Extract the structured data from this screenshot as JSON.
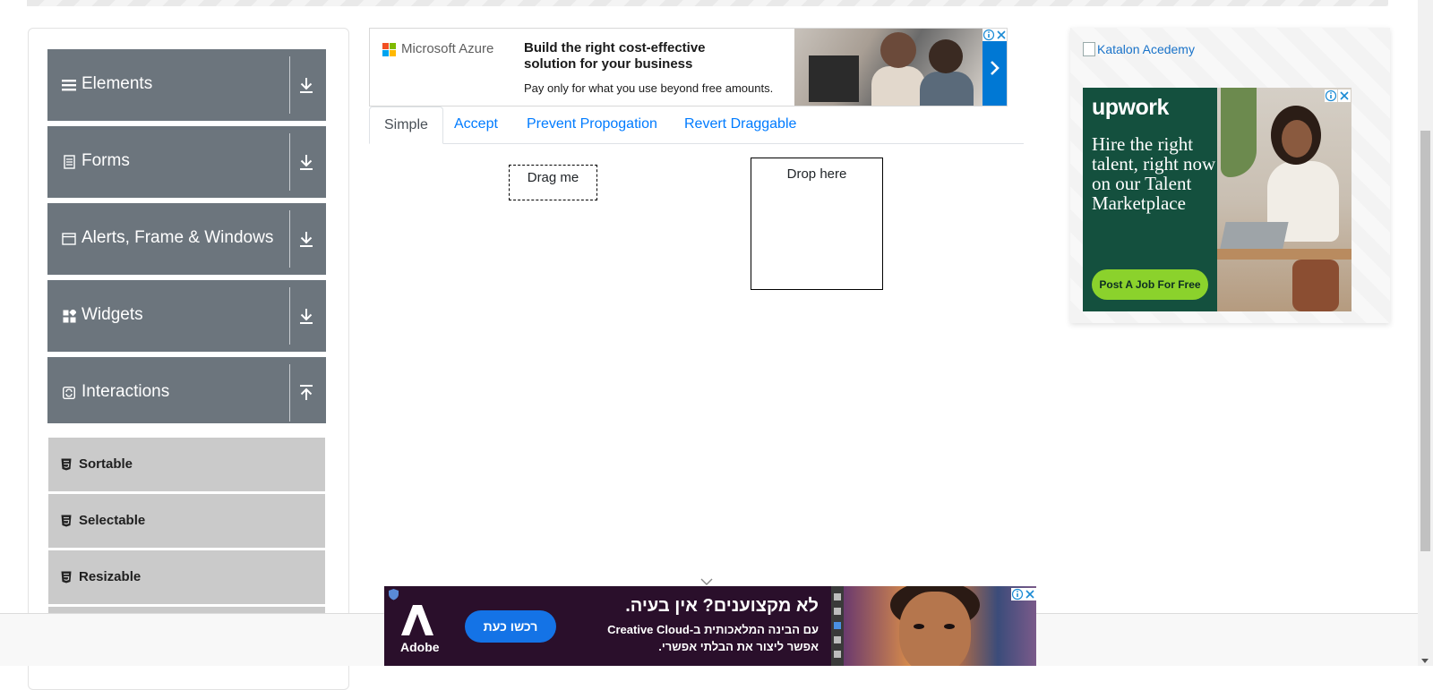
{
  "sidebar": {
    "groups": [
      {
        "label": "Elements",
        "icon": "menu-lines-icon",
        "expanded": false
      },
      {
        "label": "Forms",
        "icon": "form-icon",
        "expanded": false
      },
      {
        "label": "Alerts, Frame & Windows",
        "icon": "window-icon",
        "expanded": false
      },
      {
        "label": "Widgets",
        "icon": "widgets-icon",
        "expanded": false
      },
      {
        "label": "Interactions",
        "icon": "interactions-icon",
        "expanded": true
      }
    ],
    "interaction_items": [
      {
        "label": "Sortable",
        "icon": "html5-icon"
      },
      {
        "label": "Selectable",
        "icon": "html5-icon"
      },
      {
        "label": "Resizable",
        "icon": "html5-icon"
      }
    ],
    "colors": {
      "header_bg": "#6c757d",
      "item_bg": "#cacaca"
    }
  },
  "ad_top": {
    "brand": "Microsoft Azure",
    "headline": "Build the right cost-effective solution for your business",
    "subtext": "Pay only for what you use beyond free amounts.",
    "accent": "#0078d4"
  },
  "tabs": [
    {
      "label": "Simple",
      "active": true
    },
    {
      "label": "Accept",
      "active": false
    },
    {
      "label": "Prevent Propogation",
      "active": false
    },
    {
      "label": "Revert Draggable",
      "active": false
    }
  ],
  "drag": {
    "draggable_label": "Drag me",
    "droppable_label": "Drop here"
  },
  "ad_right": {
    "broken_image_alt": "Katalon Acedemy",
    "brand": "upwork",
    "headline": "Hire the right talent, right now on our Talent Marketplace",
    "cta": "Post A Job For Free",
    "colors": {
      "panel": "#14503e",
      "cta": "#8bd22c"
    }
  },
  "ad_bottom": {
    "brand": "Adobe",
    "cta": "רכשו כעת",
    "headline": "לא מקצוענים? אין בעיה.",
    "line1": "עם הבינה המלאכותית ב-Creative Cloud",
    "line2": "אפשר ליצור את הבלתי אפשרי.",
    "colors": {
      "bg": "#2a0f2b",
      "button": "#1473e6"
    }
  }
}
